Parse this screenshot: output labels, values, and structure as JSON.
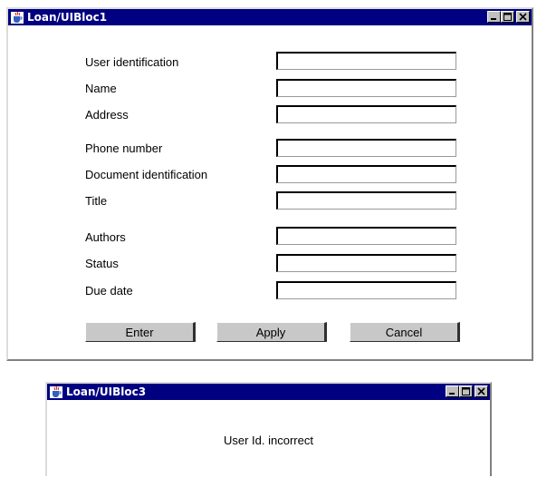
{
  "window1": {
    "title": "Loan/UIBloc1",
    "fields": [
      {
        "label": "User identification",
        "value": ""
      },
      {
        "label": "Name",
        "value": ""
      },
      {
        "label": "Address",
        "value": ""
      },
      {
        "label": "Phone number",
        "value": ""
      },
      {
        "label": "Document identification",
        "value": ""
      },
      {
        "label": "Title",
        "value": ""
      },
      {
        "label": "Authors",
        "value": ""
      },
      {
        "label": "Status",
        "value": ""
      },
      {
        "label": "Due date",
        "value": ""
      }
    ],
    "buttons": {
      "enter": "Enter",
      "apply": "Apply",
      "cancel": "Cancel"
    }
  },
  "window2": {
    "title": "Loan/UIBloc3",
    "message": "User Id. incorrect"
  },
  "colors": {
    "titlebar": "#000080",
    "button_face": "#c8c8c8"
  }
}
